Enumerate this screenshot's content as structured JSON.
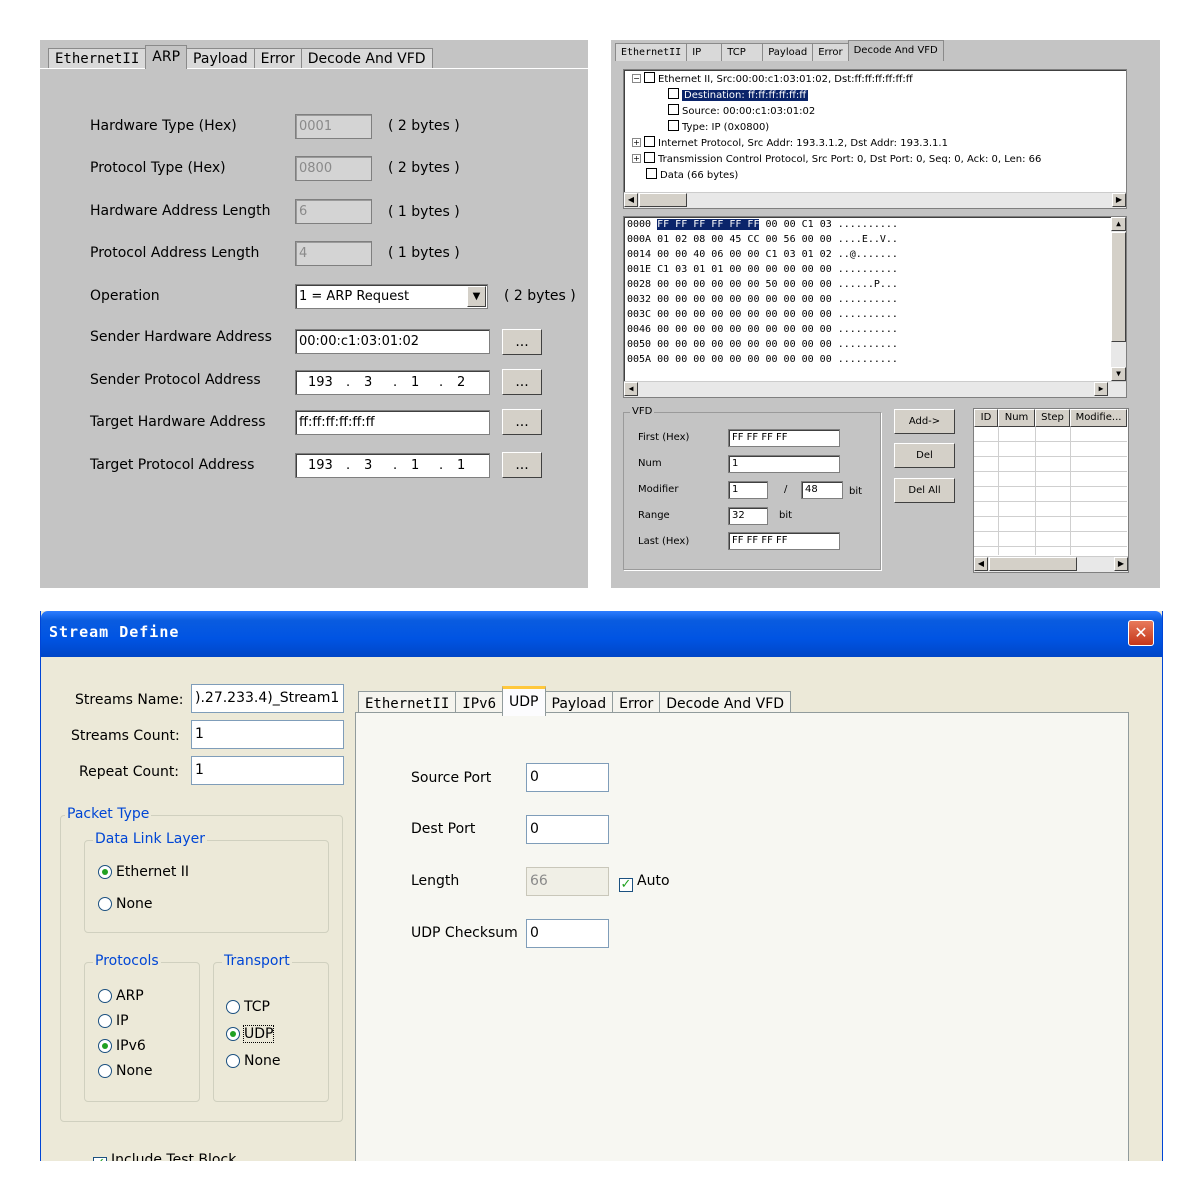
{
  "arp_panel": {
    "tabs": [
      "EthernetII",
      "ARP",
      "Payload",
      "Error",
      "Decode And VFD"
    ],
    "active_tab": "ARP",
    "fields": [
      {
        "label": "Hardware Type (Hex)",
        "value": "0001",
        "size": "( 2 bytes )"
      },
      {
        "label": "Protocol Type (Hex)",
        "value": "0800",
        "size": "( 2 bytes )"
      },
      {
        "label": "Hardware Address Length",
        "value": "6",
        "size": "( 1 bytes )"
      },
      {
        "label": "Protocol Address Length",
        "value": "4",
        "size": "( 1 bytes )"
      }
    ],
    "operation": {
      "label": "Operation",
      "value": "1 = ARP Request",
      "size": "( 2 bytes )"
    },
    "sender_hw": {
      "label": "Sender Hardware Address",
      "value": "00:00:c1:03:01:02"
    },
    "sender_proto": {
      "label": "Sender Protocol Address",
      "value": [
        "193",
        "3",
        "1",
        "2"
      ]
    },
    "target_hw": {
      "label": "Target Hardware Address",
      "value": "ff:ff:ff:ff:ff:ff"
    },
    "target_proto": {
      "label": "Target Protocol Address",
      "value": [
        "193",
        "3",
        "1",
        "1"
      ]
    },
    "browse_label": "...",
    "ip_dot": "."
  },
  "decode_panel": {
    "tabs": [
      "EthernetII",
      "IP",
      "TCP",
      "Payload",
      "Error",
      "Decode And VFD"
    ],
    "active_tab": "Decode And VFD",
    "tree": {
      "ethernet": "Ethernet II, Src:00:00:c1:03:01:02, Dst:ff:ff:ff:ff:ff:ff",
      "destination": "Destination: ff:ff:ff:ff:ff:ff",
      "source": "Source: 00:00:c1:03:01:02",
      "type": "Type: IP (0x0800)",
      "ip": "Internet Protocol, Src Addr: 193.3.1.2, Dst Addr: 193.3.1.1",
      "tcp": "Transmission Control Protocol, Src Port: 0, Dst Port: 0, Seq: 0, Ack: 0, Len: 66",
      "data": "Data (66 bytes)",
      "minus": "−",
      "plus": "+"
    },
    "hex_rows": [
      {
        "offset": "0000",
        "sel": "FF FF FF FF FF FF",
        "rest": " 00 00 C1 03 ",
        "ascii": ".........."
      },
      {
        "offset": "000A",
        "sel": "",
        "rest": "01 02 08 00 45 CC 00 56 00 00 ",
        "ascii": "....E..V.."
      },
      {
        "offset": "0014",
        "sel": "",
        "rest": "00 00 40 06 00 00 C1 03 01 02 ",
        "ascii": "..@......."
      },
      {
        "offset": "001E",
        "sel": "",
        "rest": "C1 03 01 01 00 00 00 00 00 00 ",
        "ascii": ".........."
      },
      {
        "offset": "0028",
        "sel": "",
        "rest": "00 00 00 00 00 00 50 00 00 00 ",
        "ascii": "......P..."
      },
      {
        "offset": "0032",
        "sel": "",
        "rest": "00 00 00 00 00 00 00 00 00 00 ",
        "ascii": ".........."
      },
      {
        "offset": "003C",
        "sel": "",
        "rest": "00 00 00 00 00 00 00 00 00 00 ",
        "ascii": ".........."
      },
      {
        "offset": "0046",
        "sel": "",
        "rest": "00 00 00 00 00 00 00 00 00 00 ",
        "ascii": ".........."
      },
      {
        "offset": "0050",
        "sel": "",
        "rest": "00 00 00 00 00 00 00 00 00 00 ",
        "ascii": ".........."
      },
      {
        "offset": "005A",
        "sel": "",
        "rest": "00 00 00 00 00 00 00 00 00 00 ",
        "ascii": ".........."
      }
    ],
    "vfd": {
      "group_label": "VFD",
      "first_label": "First (Hex)",
      "first_value": "FF FF FF FF",
      "num_label": "Num",
      "num_value": "1",
      "modifier_label": "Modifier",
      "modifier_value": "1",
      "modifier_slash": "/",
      "modifier_width": "48",
      "modifier_unit": "bit",
      "range_label": "Range",
      "range_value": "32",
      "range_unit": "bit",
      "last_label": "Last (Hex)",
      "last_value": "FF FF FF FF"
    },
    "buttons": {
      "add": "Add->",
      "del": "Del",
      "del_all": "Del All"
    },
    "grid_headers": [
      "ID",
      "Num",
      "Step",
      "Modifie..."
    ]
  },
  "stream_define": {
    "title": "Stream Define",
    "close": "✕",
    "streams_name_label": "Streams Name:",
    "streams_name_value": ").27.233.4)_Stream1",
    "streams_count_label": "Streams Count:",
    "streams_count_value": "1",
    "repeat_count_label": "Repeat Count:",
    "repeat_count_value": "1",
    "packet_type_label": "Packet Type",
    "data_link_label": "Data Link Layer",
    "data_link_options": [
      "Ethernet II",
      "None"
    ],
    "protocols_label": "Protocols",
    "protocol_options": [
      "ARP",
      "IP",
      "IPv6",
      "None"
    ],
    "transport_label": "Transport",
    "transport_options": [
      "TCP",
      "UDP",
      "None"
    ],
    "include_test_block": "Include Test Block",
    "tabs": [
      "EthernetII",
      "IPv6",
      "UDP",
      "Payload",
      "Error",
      "Decode And VFD"
    ],
    "active_tab": "UDP",
    "udp": {
      "source_port_label": "Source Port",
      "source_port_value": "0",
      "dest_port_label": "Dest Port",
      "dest_port_value": "0",
      "length_label": "Length",
      "length_value": "66",
      "auto_label": "Auto",
      "checksum_label": "UDP Checksum",
      "checksum_value": "0"
    },
    "check_mark": "✓"
  },
  "colors": {
    "titlebar": "#0054e3",
    "selection": "#0a246a",
    "radio_dot": "#21a121",
    "group_caption": "#0046d5"
  }
}
